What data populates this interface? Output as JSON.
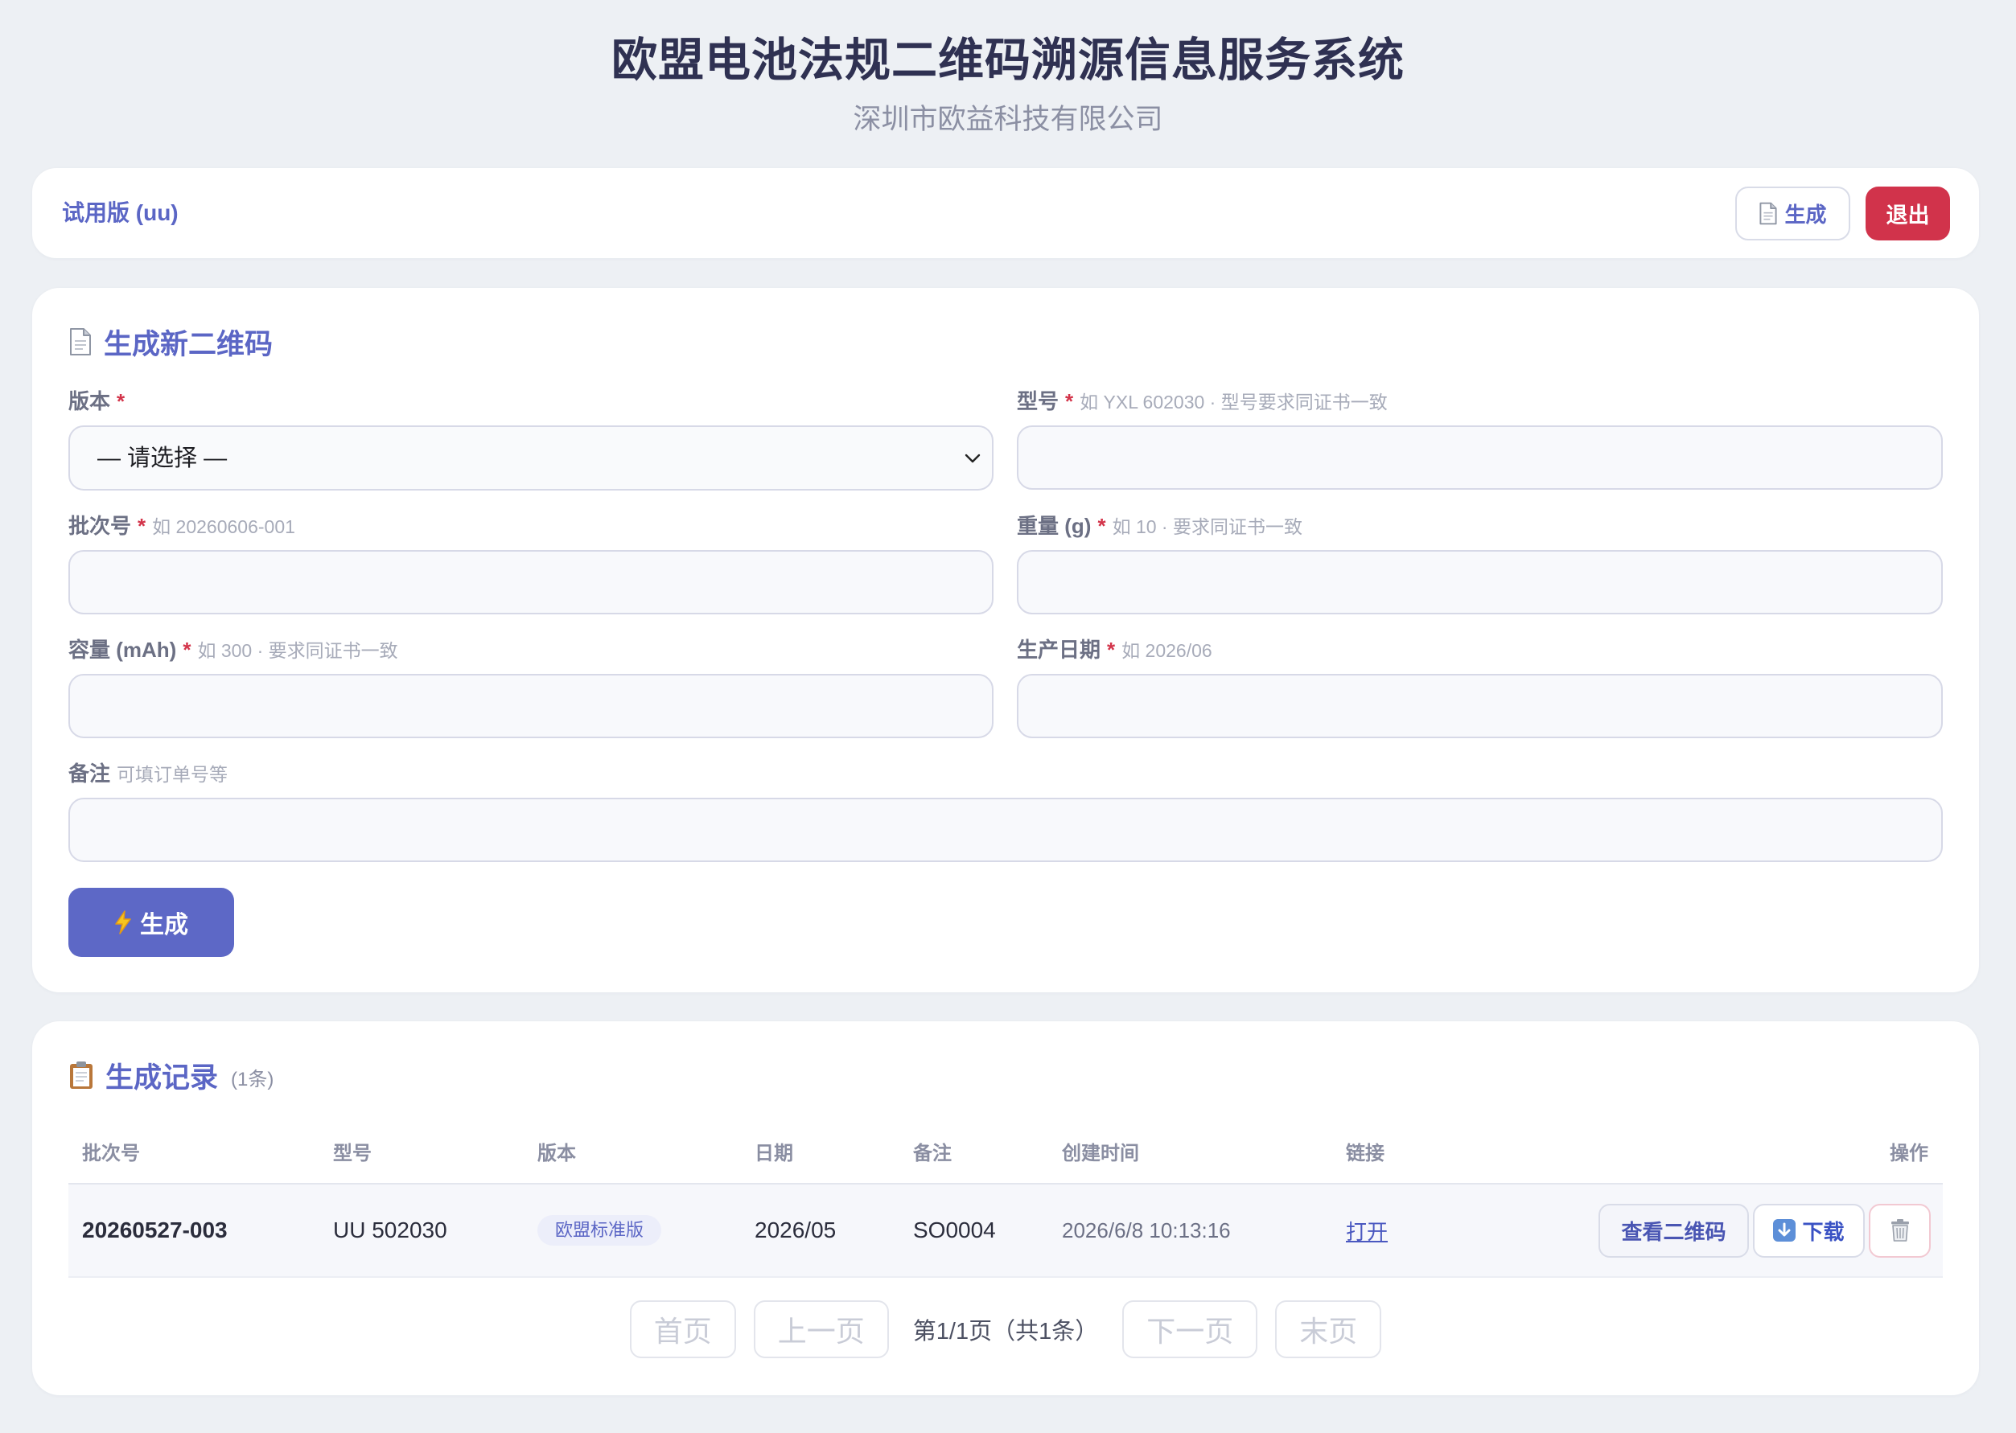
{
  "header": {
    "title": "欧盟电池法规二维码溯源信息服务系统",
    "subtitle": "深圳市欧益科技有限公司"
  },
  "topbar": {
    "account_label": "试用版 (uu)",
    "generate_button": {
      "label": "生成",
      "icon": "page-icon"
    },
    "logout_button": {
      "label": "退出"
    }
  },
  "form": {
    "heading": "生成新二维码",
    "heading_icon": "page-icon",
    "required_mark": "*",
    "fields": {
      "version": {
        "label": "版本",
        "required": true,
        "selected": "— 请选择 —"
      },
      "model": {
        "label": "型号",
        "required": true,
        "hint": "如 YXL 602030 · 型号要求同证书一致",
        "value": ""
      },
      "batch": {
        "label": "批次号",
        "required": true,
        "hint": "如 20260606-001",
        "value": ""
      },
      "weight": {
        "label": "重量 (g)",
        "required": true,
        "hint": "如 10 · 要求同证书一致",
        "value": ""
      },
      "capacity": {
        "label": "容量 (mAh)",
        "required": true,
        "hint": "如 300 · 要求同证书一致",
        "value": ""
      },
      "production_date": {
        "label": "生产日期",
        "required": true,
        "hint": "如 2026/06",
        "value": ""
      },
      "note": {
        "label": "备注",
        "required": false,
        "hint": "可填订单号等",
        "value": ""
      }
    },
    "submit_button": {
      "label": "生成",
      "icon": "lightning-icon"
    }
  },
  "records": {
    "heading": "生成记录",
    "heading_icon": "clipboard-icon",
    "count_text": "(1条)",
    "columns": [
      "批次号",
      "型号",
      "版本",
      "日期",
      "备注",
      "创建时间",
      "链接",
      "操作"
    ],
    "rows": [
      {
        "batch": "20260527-003",
        "model": "UU 502030",
        "version": "欧盟标准版",
        "date": "2026/05",
        "note": "SO0004",
        "created_at": "2026/6/8 10:13:16",
        "link_label": "打开",
        "actions": {
          "view_qr": "查看二维码",
          "download": "下载",
          "download_icon": "download-arrow-icon",
          "delete_icon": "trash-icon"
        }
      }
    ],
    "pagination": {
      "first": "首页",
      "prev": "上一页",
      "info": "第1/1页（共1条）",
      "next": "下一页",
      "last": "末页"
    }
  },
  "colors": {
    "page_background": "#edf0f4",
    "accent": "#5b66c5",
    "danger": "#d1334b",
    "required": "#d3344a",
    "text_dark": "#2f3152",
    "text_muted": "#8b8fa3"
  }
}
